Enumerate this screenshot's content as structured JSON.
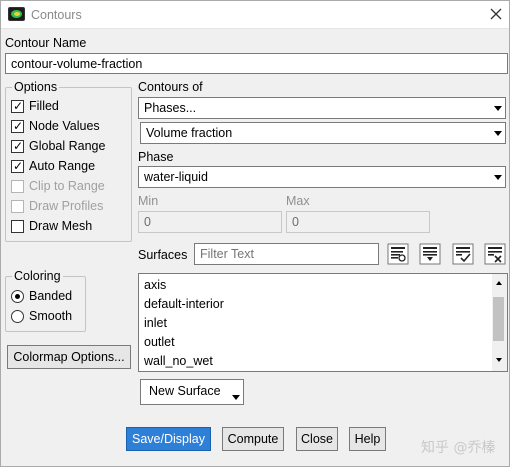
{
  "window": {
    "title": "Contours"
  },
  "contour_name": {
    "label": "Contour Name",
    "value": "contour-volume-fraction"
  },
  "options": {
    "title": "Options",
    "items": [
      {
        "label": "Filled",
        "checked": true,
        "enabled": true
      },
      {
        "label": "Node Values",
        "checked": true,
        "enabled": true
      },
      {
        "label": "Global Range",
        "checked": true,
        "enabled": true
      },
      {
        "label": "Auto Range",
        "checked": true,
        "enabled": true
      },
      {
        "label": "Clip to Range",
        "checked": false,
        "enabled": false
      },
      {
        "label": "Draw Profiles",
        "checked": false,
        "enabled": false
      },
      {
        "label": "Draw Mesh",
        "checked": false,
        "enabled": true
      }
    ]
  },
  "contours_of": {
    "label": "Contours of",
    "variable": "Phases...",
    "quantity": "Volume fraction"
  },
  "phase": {
    "label": "Phase",
    "value": "water-liquid"
  },
  "range": {
    "min_label": "Min",
    "min_value": "0",
    "max_label": "Max",
    "max_value": "0"
  },
  "surfaces": {
    "label": "Surfaces",
    "filter_placeholder": "Filter Text",
    "items": [
      "axis",
      "default-interior",
      "inlet",
      "outlet",
      "wall_no_wet"
    ]
  },
  "coloring": {
    "title": "Coloring",
    "options": [
      "Banded",
      "Smooth"
    ],
    "selected": "Banded"
  },
  "buttons": {
    "colormap": "Colormap Options...",
    "new_surface": "New Surface",
    "save_display": "Save/Display",
    "compute": "Compute",
    "close": "Close",
    "help": "Help"
  },
  "watermark": "知乎 @乔榛",
  "colors": {
    "primary_button": "#2d7fd8"
  }
}
